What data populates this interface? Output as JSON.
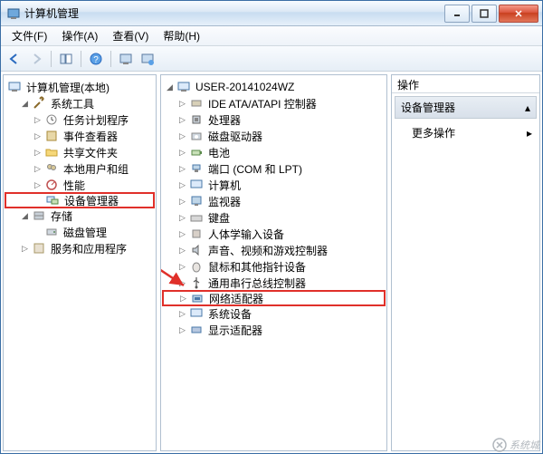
{
  "window": {
    "title": "计算机管理"
  },
  "menu": {
    "file": "文件(F)",
    "action": "操作(A)",
    "view": "查看(V)",
    "help": "帮助(H)"
  },
  "left_tree": {
    "root": "计算机管理(本地)",
    "system_tools": "系统工具",
    "task_scheduler": "任务计划程序",
    "event_viewer": "事件查看器",
    "shared_folders": "共享文件夹",
    "local_users": "本地用户和组",
    "performance": "性能",
    "device_manager": "设备管理器",
    "storage": "存储",
    "disk_mgmt": "磁盘管理",
    "services_apps": "服务和应用程序"
  },
  "mid_tree": {
    "root": "USER-20141024WZ",
    "ide": "IDE ATA/ATAPI 控制器",
    "cpu": "处理器",
    "disk_drives": "磁盘驱动器",
    "battery": "电池",
    "ports": "端口 (COM 和 LPT)",
    "computer": "计算机",
    "monitor": "监视器",
    "keyboard": "键盘",
    "hid": "人体学输入设备",
    "sound": "声音、视频和游戏控制器",
    "mouse": "鼠标和其他指针设备",
    "usb": "通用串行总线控制器",
    "network": "网络适配器",
    "system_dev": "系统设备",
    "display": "显示适配器"
  },
  "right": {
    "header": "操作",
    "selected": "设备管理器",
    "more": "更多操作"
  },
  "watermark": "系统城"
}
